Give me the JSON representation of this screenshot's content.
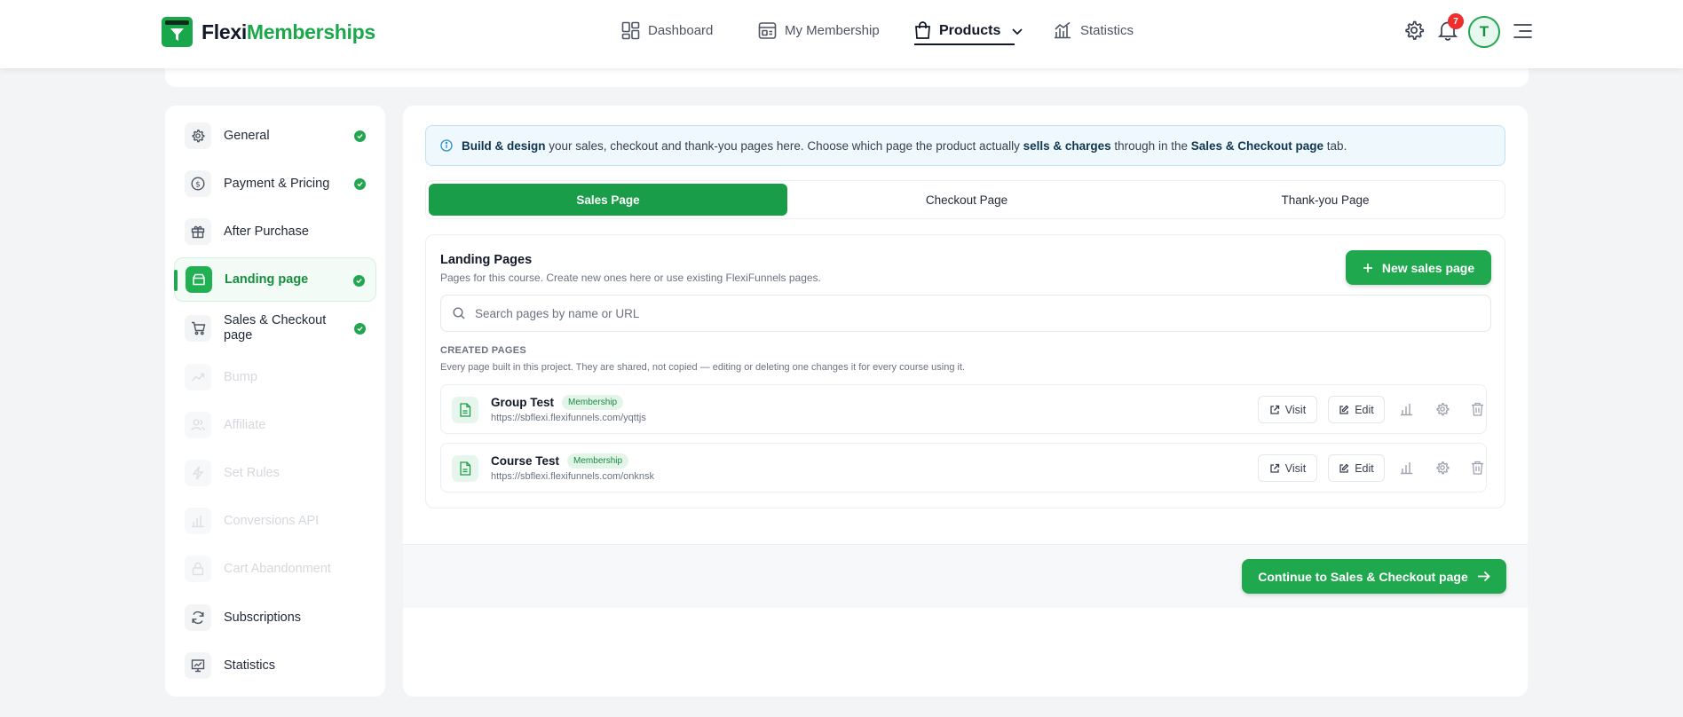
{
  "app": {
    "logo_part1": "Flexi",
    "logo_part2": "Memberships"
  },
  "nav": {
    "items": [
      {
        "label": "Dashboard",
        "icon": "dashboard-icon"
      },
      {
        "label": "My Membership",
        "icon": "membership-icon"
      },
      {
        "label": "Products",
        "icon": "shopping-bag-icon",
        "active": true
      },
      {
        "label": "Statistics",
        "icon": "bar-chart-icon"
      }
    ],
    "notification_count": "7",
    "avatar_initial": "T"
  },
  "sidebar": {
    "items": [
      {
        "label": "General",
        "icon": "gear-icon",
        "complete": true
      },
      {
        "label": "Payment & Pricing",
        "icon": "dollar-icon",
        "complete": true
      },
      {
        "label": "After Purchase",
        "icon": "gift-icon",
        "complete": false
      },
      {
        "label": "Landing page",
        "icon": "page-icon",
        "complete": true,
        "active": true
      },
      {
        "label": "Sales & Checkout page",
        "icon": "cart-icon",
        "complete": true
      },
      {
        "label": "Bump",
        "icon": "trend-icon",
        "disabled": true
      },
      {
        "label": "Affiliate",
        "icon": "users-icon",
        "disabled": true
      },
      {
        "label": "Set Rules",
        "icon": "bolt-icon",
        "disabled": true
      },
      {
        "label": "Conversions API",
        "icon": "chart-icon",
        "disabled": true
      },
      {
        "label": "Cart Abandonment",
        "icon": "lock-icon",
        "disabled": true
      },
      {
        "label": "Subscriptions",
        "icon": "refresh-icon"
      },
      {
        "label": "Statistics",
        "icon": "presentation-icon"
      }
    ]
  },
  "info": {
    "b1": "Build & design",
    "t1": " your sales, checkout and thank-you pages here. Choose which page the product actually ",
    "b2": "sells & charges",
    "t2": " through in the ",
    "b3": "Sales & Checkout page",
    "t3": " tab."
  },
  "tabs": [
    "Sales Page",
    "Checkout Page",
    "Thank-you Page"
  ],
  "panel": {
    "title": "Landing Pages",
    "subtitle": "Pages for this course. Create new ones here or use existing FlexiFunnels pages.",
    "new_button": "New sales page",
    "search_placeholder": "Search pages by name or URL",
    "section_label": "CREATED PAGES",
    "section_desc": "Every page built in this project. They are shared, not copied — editing or deleting one changes it for every course using it.",
    "pages": [
      {
        "name": "Group Test",
        "tag": "Membership",
        "url": "https://sbflexi.flexifunnels.com/yqttjs"
      },
      {
        "name": "Course Test",
        "tag": "Membership",
        "url": "https://sbflexi.flexifunnels.com/onknsk"
      }
    ],
    "visit_label": "Visit",
    "edit_label": "Edit"
  },
  "footer": {
    "continue_label": "Continue to Sales & Checkout page"
  },
  "colors": {
    "accent": "#1fa84e",
    "badge": "#ef2d2d",
    "info_bg": "#eef8fd"
  }
}
